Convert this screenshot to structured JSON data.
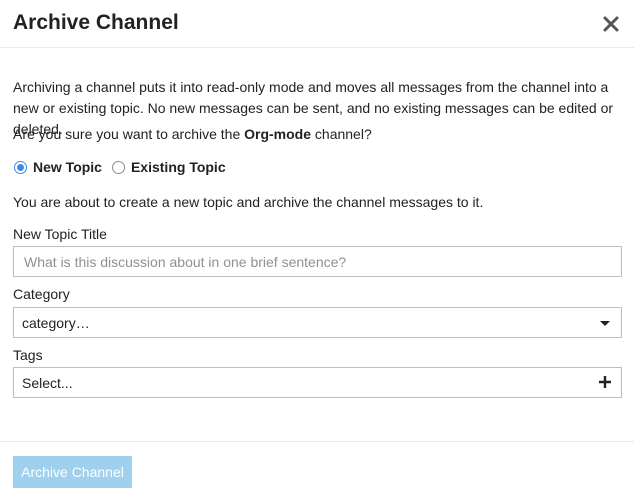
{
  "modal": {
    "title": "Archive Channel",
    "close_icon": "close-icon"
  },
  "body": {
    "description": "Archiving a channel puts it into read-only mode and moves all messages from the channel into a new or existing topic. No new messages can be sent, and no existing messages can be edited or deleted.",
    "question_prefix": "Are you sure you want to archive the ",
    "channel_name": "Org-mode",
    "question_suffix": " channel?",
    "radio_options": [
      {
        "label": "New Topic",
        "checked": true
      },
      {
        "label": "Existing Topic",
        "checked": false
      }
    ],
    "about_text": "You are about to create a new topic and archive the channel messages to it."
  },
  "form": {
    "topic_title_label": "New Topic Title",
    "topic_title_placeholder": "What is this discussion about in one brief sentence?",
    "topic_title_value": "",
    "category_label": "Category",
    "category_value": "category…",
    "tags_label": "Tags",
    "tags_value": "Select..."
  },
  "footer": {
    "submit_label": "Archive Channel",
    "submit_disabled": true
  },
  "colors": {
    "accent": "#3b8ce6",
    "disabled_button": "#9fd0ee"
  }
}
